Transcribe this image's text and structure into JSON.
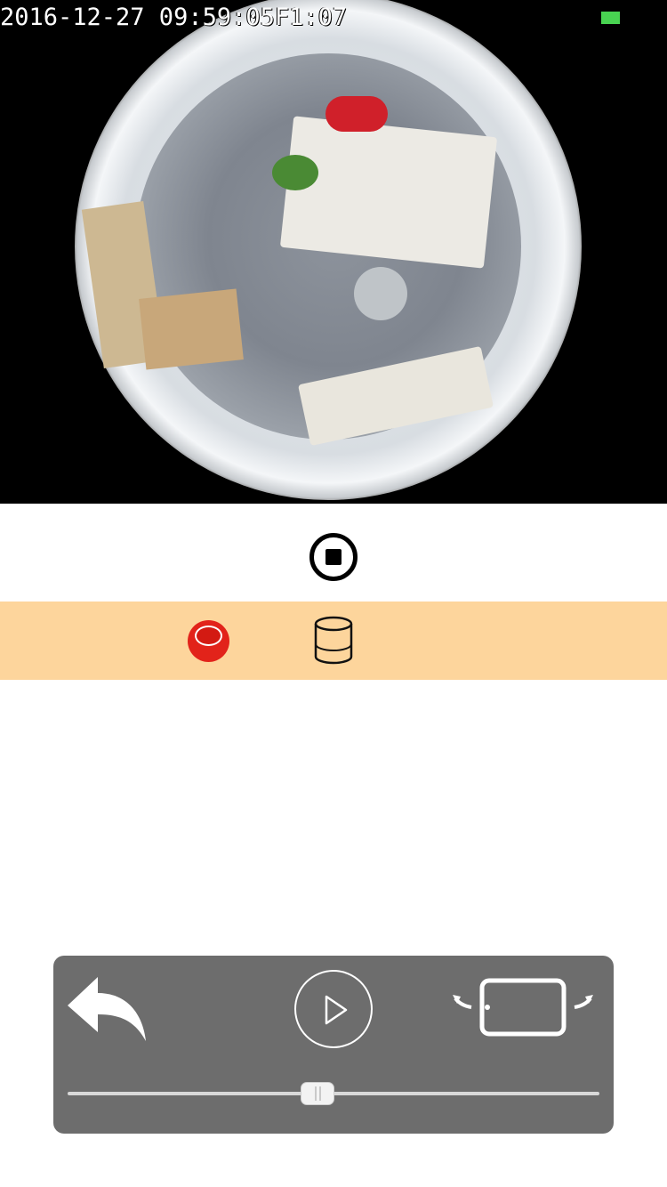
{
  "video": {
    "overlay_text": "2016-12-27 09:59:05F1:07",
    "status_indicator_color": "#48d351",
    "view": "fisheye-camera-feed"
  },
  "controls_top": {
    "stop_icon": "stop-circle-icon"
  },
  "action_bar": {
    "background": "#fdd59c",
    "record_icon": "record-icon",
    "record_color": "#e2231a",
    "storage_icon": "storage-cylinder-icon"
  },
  "playback_panel": {
    "background": "#6d6d6d",
    "back_icon": "reply-back-icon",
    "play_icon": "play-icon",
    "rotate_icon": "rotate-screen-icon",
    "progress_fraction": 0.47
  }
}
